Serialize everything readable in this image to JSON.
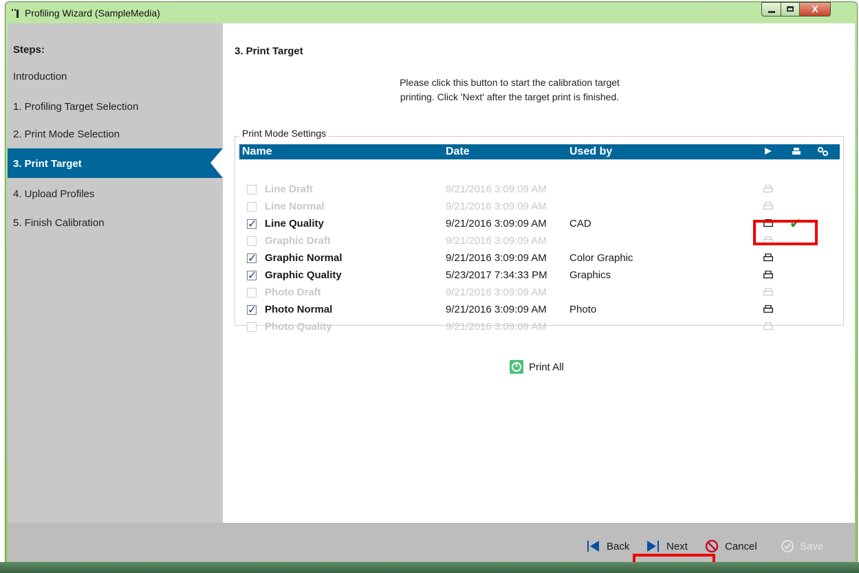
{
  "window": {
    "title": "Profiling Wizard (SampleMedia)",
    "close_label": "X"
  },
  "sidebar": {
    "title": "Steps:",
    "items": [
      {
        "label": "Introduction"
      },
      {
        "label": "1. Profiling Target Selection"
      },
      {
        "label": "2. Print Mode Selection"
      },
      {
        "label": "3. Print Target"
      },
      {
        "label": "4. Upload Profiles"
      },
      {
        "label": "5. Finish Calibration"
      }
    ],
    "active_index": 3
  },
  "main": {
    "title": "3. Print Target",
    "instruction_line1": "Please click this button to start the calibration target",
    "instruction_line2": "printing. Click 'Next' after the target print is finished.",
    "group_label": "Print Mode Settings",
    "columns": {
      "name": "Name",
      "date": "Date",
      "used_by": "Used by"
    },
    "rows": [
      {
        "name": "Line Draft",
        "date": "9/21/2016 3:09:09 AM",
        "used_by": "",
        "checked": false,
        "enabled": false,
        "printed": false
      },
      {
        "name": "Line Normal",
        "date": "9/21/2016 3:09:09 AM",
        "used_by": "",
        "checked": false,
        "enabled": false,
        "printed": false
      },
      {
        "name": "Line Quality",
        "date": "9/21/2016 3:09:09 AM",
        "used_by": "CAD",
        "checked": true,
        "enabled": true,
        "printed": true
      },
      {
        "name": "Graphic Draft",
        "date": "9/21/2016 3:09:09 AM",
        "used_by": "",
        "checked": false,
        "enabled": false,
        "printed": false
      },
      {
        "name": "Graphic Normal",
        "date": "9/21/2016 3:09:09 AM",
        "used_by": "Color Graphic",
        "checked": true,
        "enabled": true,
        "printed": false
      },
      {
        "name": "Graphic Quality",
        "date": "5/23/2017 7:34:33 PM",
        "used_by": "Graphics",
        "checked": true,
        "enabled": true,
        "printed": false
      },
      {
        "name": "Photo Draft",
        "date": "9/21/2016 3:09:09 AM",
        "used_by": "",
        "checked": false,
        "enabled": false,
        "printed": false
      },
      {
        "name": "Photo Normal",
        "date": "9/21/2016 3:09:09 AM",
        "used_by": "Photo",
        "checked": true,
        "enabled": true,
        "printed": false
      },
      {
        "name": "Photo Quality",
        "date": "9/21/2016 3:09:09 AM",
        "used_by": "",
        "checked": false,
        "enabled": false,
        "printed": false
      }
    ],
    "print_all_label": "Print All"
  },
  "footer": {
    "back_label": "Back",
    "next_label": "Next",
    "cancel_label": "Cancel",
    "save_label": "Save"
  },
  "colors": {
    "accent": "#01669a",
    "sidebar": "#c8c8c8",
    "highlight": "#ee0000",
    "ok": "#1f8f24"
  }
}
